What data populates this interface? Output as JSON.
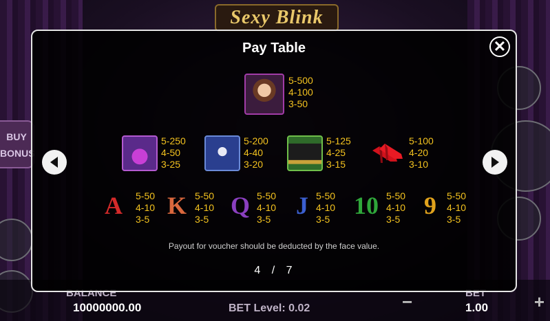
{
  "game": {
    "logo_text": "Sexy Blink",
    "buy_bonus_label": [
      "BUY",
      "BONUS"
    ]
  },
  "bottom_bar": {
    "balance_label": "BALANCE",
    "balance_value": "10000000.00",
    "bet_level_label": "BET Level:",
    "bet_level_value": "0.02",
    "bet_label": "BET",
    "bet_value": "1.00"
  },
  "paytable": {
    "title": "Pay Table",
    "note": "Payout for voucher should be deducted by the face value.",
    "page_current": "4",
    "page_separator": "/",
    "page_total": "7",
    "top_symbol": {
      "icon": "woman-portrait-icon",
      "pays": [
        "5-500",
        "4-100",
        "3-50"
      ]
    },
    "mid_symbols": [
      {
        "icon": "perfume-bottle-icon",
        "pays": [
          "5-250",
          "4-50",
          "3-25"
        ]
      },
      {
        "icon": "cocktail-glass-icon",
        "pays": [
          "5-200",
          "4-40",
          "3-20"
        ]
      },
      {
        "icon": "top-hat-icon",
        "pays": [
          "5-125",
          "4-25",
          "3-15"
        ]
      },
      {
        "icon": "red-heels-icon",
        "pays": [
          "5-100",
          "4-20",
          "3-10"
        ]
      }
    ],
    "card_symbols": [
      {
        "label": "A",
        "color": "#d42a2a",
        "pays": [
          "5-50",
          "4-10",
          "3-5"
        ]
      },
      {
        "label": "K",
        "color": "#d9673d",
        "pays": [
          "5-50",
          "4-10",
          "3-5"
        ]
      },
      {
        "label": "Q",
        "color": "#8a3fbf",
        "pays": [
          "5-50",
          "4-10",
          "3-5"
        ]
      },
      {
        "label": "J",
        "color": "#3b5fd0",
        "pays": [
          "5-50",
          "4-10",
          "3-5"
        ]
      },
      {
        "label": "10",
        "color": "#2fa63a",
        "pays": [
          "5-50",
          "4-10",
          "3-5"
        ]
      },
      {
        "label": "9",
        "color": "#e0a21c",
        "pays": [
          "5-50",
          "4-10",
          "3-5"
        ]
      }
    ]
  },
  "colors": {
    "pay_text": "#f3c21f",
    "modal_border": "#e6e6e6"
  }
}
